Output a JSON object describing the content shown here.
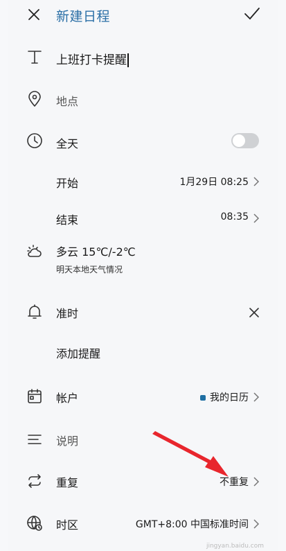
{
  "header": {
    "title": "新建日程"
  },
  "event_title": {
    "value": "上班打卡提醒"
  },
  "location": {
    "placeholder": "地点"
  },
  "all_day": {
    "label": "全天",
    "enabled": false
  },
  "start": {
    "label": "开始",
    "value": "1月29日 08:25"
  },
  "end": {
    "label": "结束",
    "value": "08:35"
  },
  "weather": {
    "label": "多云 15℃/-2℃",
    "sub": "明天本地天气情况"
  },
  "reminder": {
    "label": "准时"
  },
  "add_reminder": {
    "label": "添加提醒"
  },
  "account": {
    "label": "帐户",
    "value": "我的日历",
    "color": "#1f6fa3"
  },
  "notes": {
    "placeholder": "说明"
  },
  "repeat": {
    "label": "重复",
    "value": "不重复"
  },
  "timezone": {
    "label": "时区",
    "value": "GMT+8:00 中国标准时间"
  },
  "annotation": {
    "arrow_color": "#e8262d"
  },
  "watermark": {
    "text": "jingyan.baidu.com"
  }
}
